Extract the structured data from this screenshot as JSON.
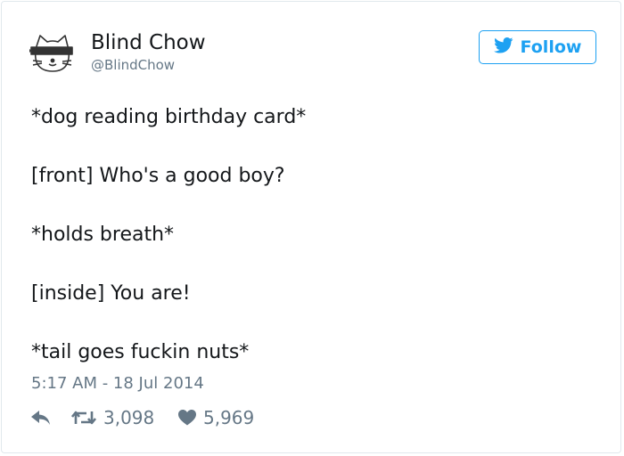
{
  "user": {
    "display_name": "Blind Chow",
    "handle": "@BlindChow",
    "avatar_icon": "blindfolded-cat-icon"
  },
  "follow_button": {
    "label": "Follow",
    "icon": "twitter-bird-icon",
    "color": "#1da1f2"
  },
  "tweet": {
    "lines": [
      "*dog reading birthday card*",
      "[front] Who's a good boy?",
      "*holds breath*",
      "[inside] You are!",
      "*tail goes fuckin nuts*"
    ],
    "timestamp": "5:17 AM - 18 Jul 2014"
  },
  "actions": {
    "reply_icon": "reply-icon",
    "retweet_icon": "retweet-icon",
    "retweets": "3,098",
    "like_icon": "heart-icon",
    "likes": "5,969"
  }
}
